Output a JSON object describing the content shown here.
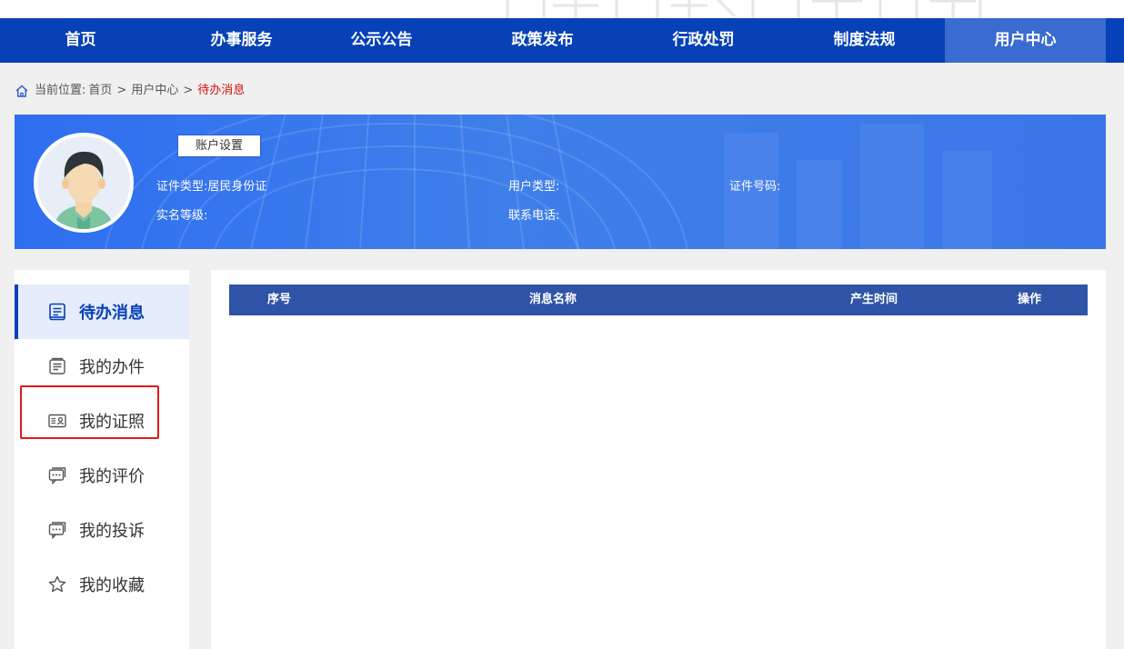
{
  "nav": {
    "items": [
      {
        "label": "首页"
      },
      {
        "label": "办事服务"
      },
      {
        "label": "公示公告"
      },
      {
        "label": "政策发布"
      },
      {
        "label": "行政处罚"
      },
      {
        "label": "制度法规"
      },
      {
        "label": "用户中心"
      }
    ],
    "active_index": 6
  },
  "breadcrumb": {
    "prefix": "当前位置:",
    "items": [
      "首页",
      "用户中心"
    ],
    "current": "待办消息",
    "separator": ">"
  },
  "profile": {
    "account_button": "账户设置",
    "cert_type_label": "证件类型:",
    "cert_type_value": "居民身份证",
    "user_type_label": "用户类型:",
    "cert_no_label": "证件号码:",
    "real_name_level_label": "实名等级:",
    "phone_label": "联系电话:"
  },
  "sidebar": {
    "items": [
      {
        "label": "待办消息",
        "icon": "message-list-icon",
        "active": true
      },
      {
        "label": "我的办件",
        "icon": "document-stack-icon"
      },
      {
        "label": "我的证照",
        "icon": "id-card-icon",
        "highlighted": true
      },
      {
        "label": "我的评价",
        "icon": "chat-bubble-icon"
      },
      {
        "label": "我的投诉",
        "icon": "chat-bubble-icon"
      },
      {
        "label": "我的收藏",
        "icon": "star-icon"
      }
    ]
  },
  "table": {
    "columns": [
      "序号",
      "消息名称",
      "产生时间",
      "操作"
    ]
  },
  "colors": {
    "nav_bg": "#0641b7",
    "nav_active": "#3a6bd0",
    "table_header": "#2f54a7",
    "breadcrumb_current": "#d60f0f",
    "highlight_border": "#e0191b"
  }
}
